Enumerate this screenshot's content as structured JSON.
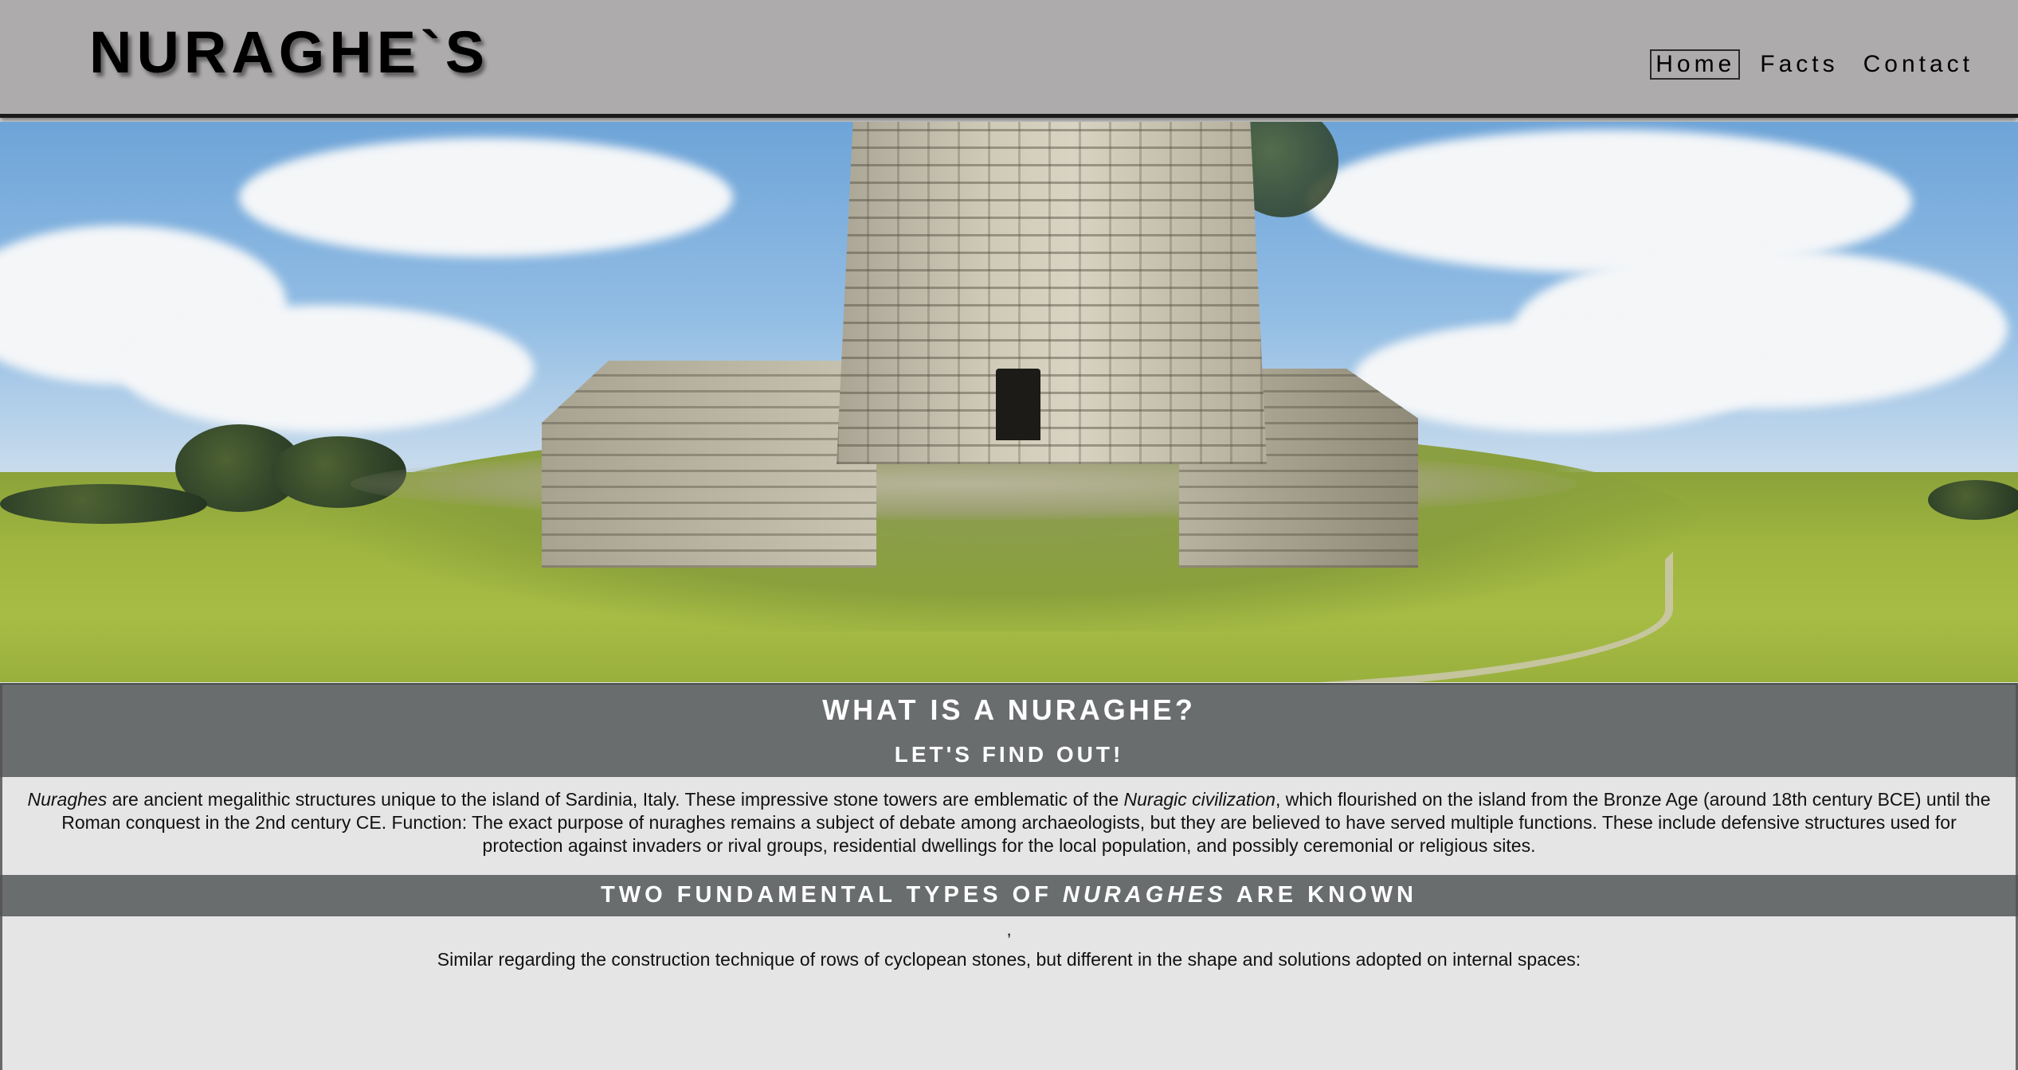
{
  "header": {
    "logo": "NURAGHE`S",
    "nav": {
      "home": "Home",
      "facts": "Facts",
      "contact": "Contact"
    }
  },
  "hero": {
    "description_icon": "nuraghe-photo"
  },
  "intro": {
    "title": "WHAT IS A NURAGHE?",
    "subtitle": "LET'S FIND OUT!",
    "term": "Nuraghes",
    "text_1": " are ancient megalithic structures unique to the island of Sardinia, Italy. These impressive stone towers are emblematic of the ",
    "civilization": "Nuragic civilization",
    "text_2": ", which flourished on the island from the Bronze Age (around 18th century BCE) until the Roman conquest in the 2nd century CE. Function: The exact purpose of nuraghes remains a subject of debate among archaeologists, but they are believed to have served multiple functions. These include defensive structures used for protection against invaders or rival groups, residential dwellings for the local population, and possibly ceremonial or religious sites."
  },
  "types": {
    "title_prefix": "TWO FUNDAMENTAL TYPES OF ",
    "title_term": "NURAGHES",
    "title_suffix": " ARE KNOWN",
    "comma": ",",
    "text": "Similar regarding the construction technique of rows of cyclopean stones, but different in the shape and solutions adopted on internal spaces:"
  },
  "colors": {
    "header_bg": "#adabab",
    "band_bg": "#6a6d6e",
    "content_bg": "#e4e5e4"
  }
}
